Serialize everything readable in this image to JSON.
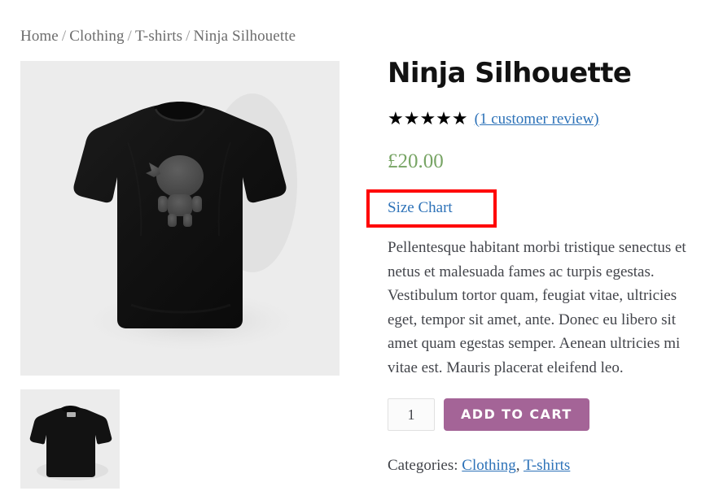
{
  "breadcrumb": {
    "separator": "/",
    "items": [
      {
        "label": "Home"
      },
      {
        "label": "Clothing"
      },
      {
        "label": "T-shirts"
      },
      {
        "label": "Ninja Silhouette"
      }
    ]
  },
  "gallery": {
    "main_image_alt": "Ninja Silhouette black t-shirt front view",
    "thumbnail_alt": "Ninja Silhouette black t-shirt back view",
    "background_color": "#ececec",
    "shirt_color": "#111111",
    "graphic_color": "#7a7a7a"
  },
  "product": {
    "title": "Ninja Silhouette",
    "rating": {
      "stars": "★★★★★",
      "value": 5,
      "max": 5,
      "review_link": "(1 customer review)",
      "review_count": 1
    },
    "price": "£20.00",
    "price_color": "#77a464",
    "size_chart_label": "Size Chart",
    "highlight_color": "#ff0000",
    "description": "Pellentesque habitant morbi tristique senectus et netus et malesuada fames ac turpis egestas. Vestibulum tortor quam, feugiat vitae, ultricies eget, tempor sit amet, ante. Donec eu libero sit amet quam egestas semper. Aenean ultricies mi vitae est. Mauris placerat eleifend leo.",
    "quantity": "1",
    "quantity_placeholder": "1",
    "add_to_cart_label": "Add to cart",
    "add_to_cart_color": "#a46497",
    "categories_label": "Categories:",
    "categories": [
      {
        "label": "Clothing"
      },
      {
        "label": "T-shirts"
      }
    ],
    "categories_separator": ","
  }
}
